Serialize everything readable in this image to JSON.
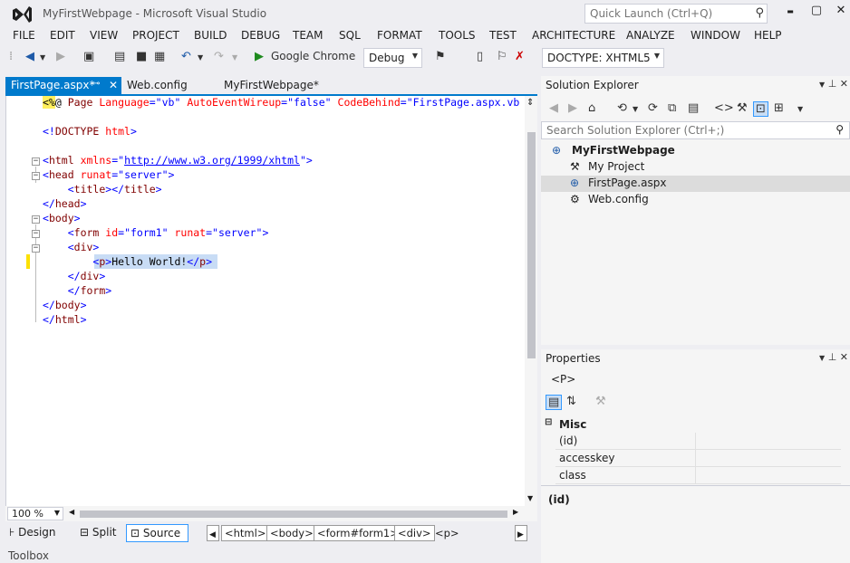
{
  "window": {
    "title": "MyFirstWebpage - Microsoft Visual Studio",
    "quick_launch_placeholder": "Quick Launch (Ctrl+Q)",
    "minimize": "▬",
    "maximize": "▢"
  },
  "menu": [
    "FILE",
    "EDIT",
    "VIEW",
    "PROJECT",
    "BUILD",
    "DEBUG",
    "TEAM",
    "SQL",
    "FORMAT",
    "TOOLS",
    "TEST",
    "ARCHITECTURE",
    "ANALYZE",
    "WINDOW",
    "HELP"
  ],
  "toolbar": {
    "browser": "Google Chrome",
    "configuration": "Debug",
    "doctype": "DOCTYPE: XHTML5"
  },
  "tabs": [
    {
      "label": "FirstPage.aspx*",
      "active": true
    },
    {
      "label": "Web.config",
      "active": false
    },
    {
      "label": "MyFirstWebpage*",
      "active": false
    }
  ],
  "code": {
    "line1_pct": "<%",
    "line1_at": "@",
    "line1_page": " Page ",
    "line1_lang_attr": "Language",
    "line1_lang_val": "\"vb\"",
    "line1_aew_attr": "AutoEventWireup",
    "line1_aew_val": "\"false\"",
    "line1_cb_attr": "CodeBehind",
    "line1_cb_val": "\"FirstPage.aspx.vb",
    "doctype": "<!DOCTYPE html>",
    "html_open_tag": "html",
    "html_xmlns_attr": "xmlns",
    "html_xmlns_val": "http://www.w3.org/1999/xhtml",
    "head_open": "head",
    "runat_attr": "runat",
    "server_val": "\"server\"",
    "title_line": "title",
    "head_close": "head",
    "body_open": "body",
    "form_tag": "form",
    "id_attr": "id",
    "form1_val": "\"form1\"",
    "div_open": "div",
    "p_tag": "p",
    "hello": "Hello World!",
    "div_close": "div",
    "form_close": "form",
    "body_close": "body",
    "html_close": "html"
  },
  "editor": {
    "zoom": "100 %"
  },
  "viewbar": {
    "design": "Design",
    "split": "Split",
    "source": "Source",
    "crumbs": [
      "<html>",
      "<body>",
      "<form#form1>",
      "<div>",
      "<p>"
    ]
  },
  "statusbar": {
    "toolbox": "Toolbox"
  },
  "solution_explorer": {
    "title": "Solution Explorer",
    "search_placeholder": "Search Solution Explorer (Ctrl+;)",
    "items": [
      {
        "label": "MyFirstWebpage",
        "level": 0,
        "selected": false
      },
      {
        "label": "My Project",
        "level": 1,
        "selected": false
      },
      {
        "label": "FirstPage.aspx",
        "level": 1,
        "selected": true
      },
      {
        "label": "Web.config",
        "level": 1,
        "selected": false
      }
    ]
  },
  "properties": {
    "title": "Properties",
    "object": "<P>",
    "category": "Misc",
    "rows": [
      "(id)",
      "accesskey",
      "class"
    ],
    "description_title": "(id)"
  }
}
